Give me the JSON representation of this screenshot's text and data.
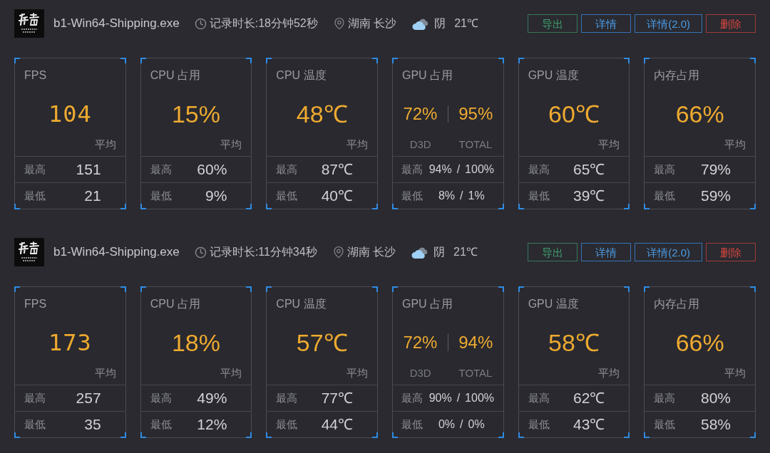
{
  "sessions": [
    {
      "app": {
        "name": "b1-Win64-Shipping.exe"
      },
      "duration": "记录时长:18分钟52秒",
      "location": "湖南 长沙",
      "weather": {
        "condition": "阴",
        "temperature": "21℃"
      },
      "buttons": [
        {
          "label": "导出",
          "kind": "export"
        },
        {
          "label": "详情",
          "kind": "detail"
        },
        {
          "label": "详情(2.0)",
          "kind": "detail"
        },
        {
          "label": "删除",
          "kind": "delete"
        }
      ],
      "cards": [
        {
          "kind": "fps",
          "title": "FPS",
          "value": "104",
          "average_label": "平均",
          "stats": [
            {
              "label": "最高",
              "value": "151"
            },
            {
              "label": "最低",
              "value": "21"
            }
          ]
        },
        {
          "kind": "single",
          "title": "CPU 占用",
          "value": "15%",
          "average_label": "平均",
          "stats": [
            {
              "label": "最高",
              "value": "60%"
            },
            {
              "label": "最低",
              "value": "9%"
            }
          ]
        },
        {
          "kind": "single",
          "title": "CPU 温度",
          "value": "48℃",
          "average_label": "平均",
          "stats": [
            {
              "label": "最高",
              "value": "87℃"
            },
            {
              "label": "最低",
              "value": "40℃"
            }
          ]
        },
        {
          "kind": "dual",
          "title": "GPU 占用",
          "values": [
            "72%",
            "95%"
          ],
          "value_labels": [
            "D3D",
            "TOTAL"
          ],
          "stats": [
            {
              "label": "最高",
              "values": [
                "94%",
                "100%"
              ],
              "separator": "/"
            },
            {
              "label": "最低",
              "values": [
                "8%",
                "1%"
              ],
              "separator": "/"
            }
          ]
        },
        {
          "kind": "single",
          "title": "GPU 温度",
          "value": "60℃",
          "average_label": "平均",
          "stats": [
            {
              "label": "最高",
              "value": "65℃"
            },
            {
              "label": "最低",
              "value": "39℃"
            }
          ]
        },
        {
          "kind": "single",
          "title": "内存占用",
          "value": "66%",
          "average_label": "平均",
          "stats": [
            {
              "label": "最高",
              "value": "79%"
            },
            {
              "label": "最低",
              "value": "59%"
            }
          ]
        }
      ]
    },
    {
      "app": {
        "name": "b1-Win64-Shipping.exe"
      },
      "duration": "记录时长:11分钟34秒",
      "location": "湖南 长沙",
      "weather": {
        "condition": "阴",
        "temperature": "21℃"
      },
      "buttons": [
        {
          "label": "导出",
          "kind": "export"
        },
        {
          "label": "详情",
          "kind": "detail"
        },
        {
          "label": "详情(2.0)",
          "kind": "detail"
        },
        {
          "label": "删除",
          "kind": "delete"
        }
      ],
      "cards": [
        {
          "kind": "fps",
          "title": "FPS",
          "value": "173",
          "average_label": "平均",
          "stats": [
            {
              "label": "最高",
              "value": "257"
            },
            {
              "label": "最低",
              "value": "35"
            }
          ]
        },
        {
          "kind": "single",
          "title": "CPU 占用",
          "value": "18%",
          "average_label": "平均",
          "stats": [
            {
              "label": "最高",
              "value": "49%"
            },
            {
              "label": "最低",
              "value": "12%"
            }
          ]
        },
        {
          "kind": "single",
          "title": "CPU 温度",
          "value": "57℃",
          "average_label": "平均",
          "stats": [
            {
              "label": "最高",
              "value": "77℃"
            },
            {
              "label": "最低",
              "value": "44℃"
            }
          ]
        },
        {
          "kind": "dual",
          "title": "GPU 占用",
          "values": [
            "72%",
            "94%"
          ],
          "value_labels": [
            "D3D",
            "TOTAL"
          ],
          "stats": [
            {
              "label": "最高",
              "values": [
                "90%",
                "100%"
              ],
              "separator": "/"
            },
            {
              "label": "最低",
              "values": [
                "0%",
                "0%"
              ],
              "separator": "/"
            }
          ]
        },
        {
          "kind": "single",
          "title": "GPU 温度",
          "value": "58℃",
          "average_label": "平均",
          "stats": [
            {
              "label": "最高",
              "value": "62℃"
            },
            {
              "label": "最低",
              "value": "43℃"
            }
          ]
        },
        {
          "kind": "single",
          "title": "内存占用",
          "value": "66%",
          "average_label": "平均",
          "stats": [
            {
              "label": "最高",
              "value": "80%"
            },
            {
              "label": "最低",
              "value": "58%"
            }
          ]
        }
      ]
    }
  ]
}
